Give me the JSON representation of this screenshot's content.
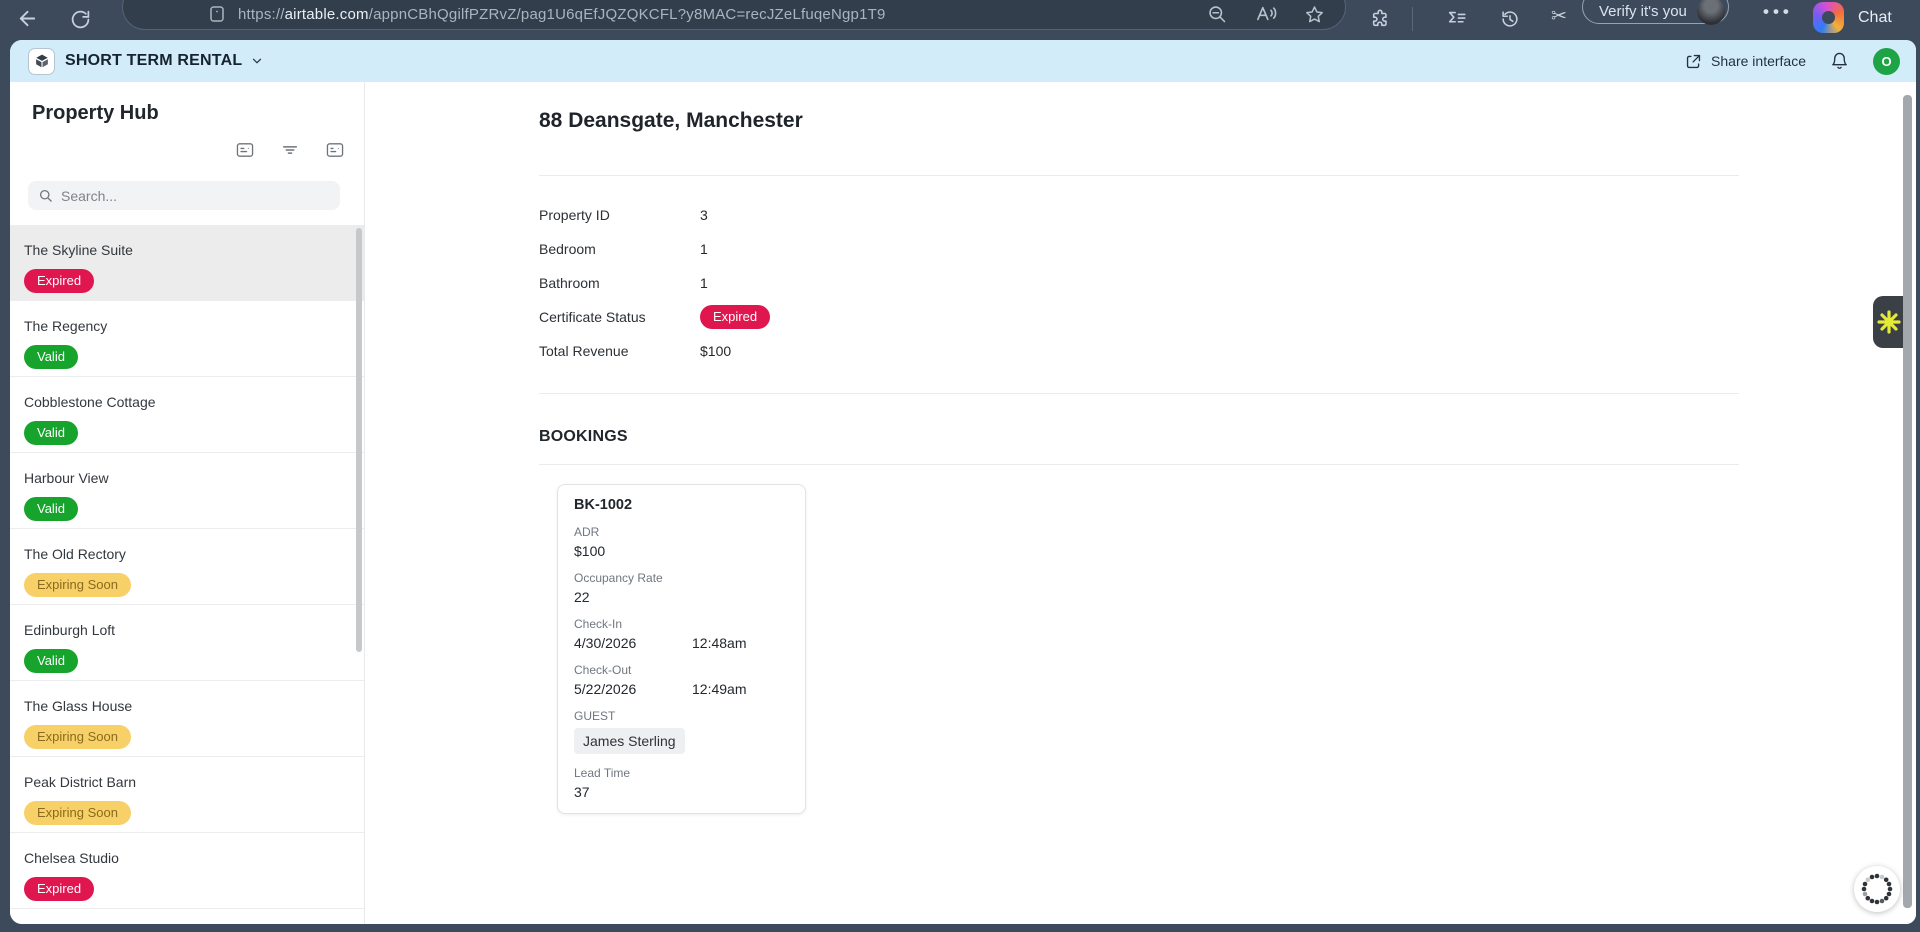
{
  "browser": {
    "url_scheme": "https://",
    "url_domain": "airtable.com",
    "url_path": "/appnCBhQgilfPZRvZ/pag1U6qEfJQZQKCFL?y8MAC=recJZeLfuqeNgp1T9",
    "verify_label": "Verify it's you",
    "chat_label": "Chat"
  },
  "icons": {
    "scissors_glyph": "✂",
    "menu_dots_glyph": "•••"
  },
  "app_header": {
    "title": "SHORT TERM RENTAL",
    "share_label": "Share interface",
    "avatar_initial": "O"
  },
  "sidebar": {
    "title": "Property Hub",
    "search_placeholder": "Search...",
    "items": [
      {
        "name": "The Skyline Suite",
        "status": "Expired",
        "selected": true
      },
      {
        "name": "The Regency",
        "status": "Valid",
        "selected": false
      },
      {
        "name": "Cobblestone Cottage",
        "status": "Valid",
        "selected": false
      },
      {
        "name": "Harbour View",
        "status": "Valid",
        "selected": false
      },
      {
        "name": "The Old Rectory",
        "status": "Expiring Soon",
        "selected": false
      },
      {
        "name": "Edinburgh Loft",
        "status": "Valid",
        "selected": false
      },
      {
        "name": "The Glass House",
        "status": "Expiring Soon",
        "selected": false
      },
      {
        "name": "Peak District Barn",
        "status": "Expiring Soon",
        "selected": false
      },
      {
        "name": "Chelsea Studio",
        "status": "Expired",
        "selected": false
      }
    ]
  },
  "record": {
    "title": "88 Deansgate, Manchester",
    "fields": [
      {
        "label": "Property ID",
        "value": "3",
        "type": "text"
      },
      {
        "label": "Bedroom",
        "value": "1",
        "type": "text"
      },
      {
        "label": "Bathroom",
        "value": "1",
        "type": "text"
      },
      {
        "label": "Certificate Status",
        "value": "Expired",
        "type": "badge"
      },
      {
        "label": "Total Revenue",
        "value": "$100",
        "type": "text"
      }
    ],
    "bookings_section_label": "BOOKINGS",
    "booking": {
      "id": "BK-1002",
      "fields": [
        {
          "label": "ADR",
          "value": "$100"
        },
        {
          "label": "Occupancy Rate",
          "value": "22"
        },
        {
          "label": "Check-In",
          "value": "4/30/2026",
          "time": "12:48am"
        },
        {
          "label": "Check-Out",
          "value": "5/22/2026",
          "time": "12:49am"
        },
        {
          "label": "GUEST",
          "value": "James Sterling",
          "tag": true
        },
        {
          "label": "Lead Time",
          "value": "37"
        }
      ]
    }
  },
  "colors": {
    "toolbar_bg": "#3d4a5c",
    "header_bg": "#d3ecf9",
    "badge_expired": "#e0164f",
    "badge_valid": "#16a42c",
    "badge_expiring_bg": "#f7d168",
    "badge_expiring_text": "#8a6a1d",
    "avatar_green": "#1ea446",
    "fly_tab_accent": "#e4ea36"
  }
}
